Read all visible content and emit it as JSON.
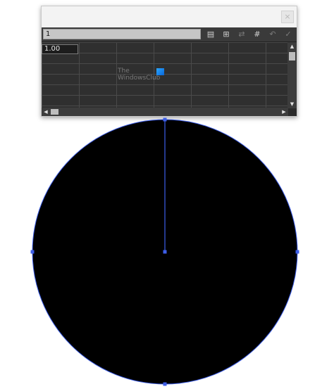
{
  "graph_data_panel": {
    "close_glyph": "×",
    "value_input": "1",
    "cell_value": "1.00",
    "watermark_line1": "The",
    "watermark_line2": "WindowsClub",
    "toolbar_icons": [
      "import-data-icon",
      "transpose-icon",
      "switch-xy-icon",
      "cell-style-icon",
      "revert-icon",
      "apply-icon"
    ]
  },
  "artwork": {
    "shape_fill": "#000000",
    "selection_color": "#3d5ee8"
  }
}
